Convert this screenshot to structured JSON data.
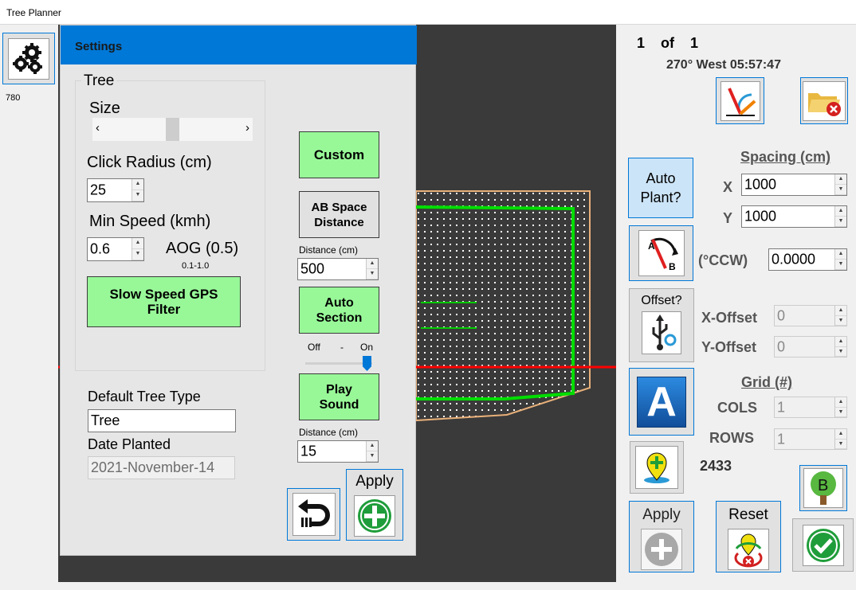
{
  "window": {
    "title": "Tree Planner"
  },
  "left": {
    "counter": "780",
    "settings_icon": "gears-icon"
  },
  "settings": {
    "header": "Settings",
    "tree_group": "Tree",
    "size_label": "Size",
    "scroll_left": "‹",
    "scroll_right": "›",
    "size_value": 0.5,
    "click_radius_label": "Click Radius (cm)",
    "click_radius_value": "25",
    "min_speed_label": "Min Speed (kmh)",
    "min_speed_value": "0.6",
    "aog_label": "AOG (0.5)",
    "aog_range": "0.1-1.0",
    "slow_speed_btn": "Slow Speed GPS Filter",
    "custom_btn": "Custom",
    "ab_space_btn": "AB Space Distance",
    "distance_label_1": "Distance (cm)",
    "distance_value_1": "500",
    "auto_section_btn": "Auto Section",
    "off_label": "Off",
    "dash_label": "-",
    "on_label": "On",
    "toggle_value": 1,
    "play_sound_btn": "Play Sound",
    "distance_label_2": "Distance (cm)",
    "distance_value_2": "15",
    "default_tree_type_label": "Default Tree Type",
    "default_tree_type_value": "Tree",
    "date_planted_label": "Date Planted",
    "date_planted_value": "2021-November-14",
    "apply_label": "Apply",
    "back_icon": "return-arrow-icon",
    "apply_icon": "plus-circle-icon"
  },
  "right": {
    "page_current": "1",
    "page_of": "of",
    "page_total": "1",
    "heading_time": "270° West 05:57:47",
    "spacing_label": "Spacing (cm)",
    "x_label": "X",
    "x_value": "1000",
    "y_label": "Y",
    "y_value": "1000",
    "auto_plant_btn": "Auto Plant?",
    "ccw_label": "(°CCW)",
    "ccw_value": "0.0000",
    "offset_btn": "Offset?",
    "x_offset_label": "X-Offset",
    "x_offset_value": "0",
    "y_offset_label": "Y-Offset",
    "y_offset_value": "0",
    "grid_label": "Grid (#)",
    "cols_label": "COLS",
    "cols_value": "1",
    "rows_label": "ROWS",
    "rows_value": "1",
    "count": "2433",
    "apply_label": "Apply",
    "reset_label": "Reset",
    "b_label": "B",
    "a_label": "A"
  },
  "colors": {
    "accent": "#0078d7",
    "green_button": "#98f898",
    "canvas": "#3a3a3a",
    "boundary": "#e8b07a",
    "track": "#00dd00",
    "ab_line": "#ff0000"
  }
}
